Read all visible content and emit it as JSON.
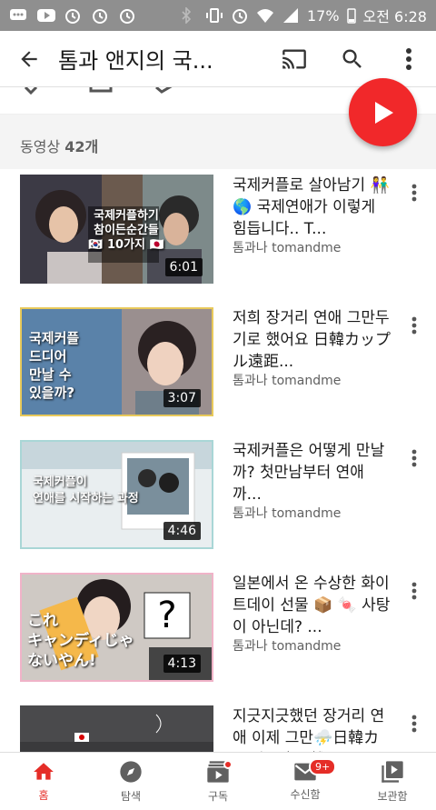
{
  "status_bar": {
    "battery": "17%",
    "time": "오전 6:28"
  },
  "app_bar": {
    "title": "톰과 앤지의 국..."
  },
  "section": {
    "count_label": "동영상",
    "count_value": "42개"
  },
  "videos": [
    {
      "title": "국제커플로 살아남기 👫🌎 국제연애가 이렇게 힘듭니다.. T...",
      "channel": "톰과나 tomandme",
      "duration": "6:01",
      "thumb_text": "국제커플하기\n참이든순간들\n🇰🇷 10가지 🇯🇵"
    },
    {
      "title": "저희 장거리 연애 그만두기로 했어요 日韓カップル遠距...",
      "channel": "톰과나 tomandme",
      "duration": "3:07",
      "thumb_text": "국제커플\n드디어\n만날 수\n있을까?"
    },
    {
      "title": "국제커플은 어떻게 만날까? 첫만남부터 연애까...",
      "channel": "톰과나 tomandme",
      "duration": "4:46",
      "thumb_text": "국제커플이\n연애를 시작하는 과정"
    },
    {
      "title": "일본에서 온 수상한 화이트데이 선물 📦 🍬 사탕이 아닌데? ...",
      "channel": "톰과나 tomandme",
      "duration": "4:13",
      "thumb_text": "これ\nキャンディじゃ\nないやん!"
    },
    {
      "title": "지긋지긋했던 장거리 연애 이제 그만⛈️日韓カップル遠距離...",
      "channel": "",
      "duration": "",
      "thumb_text": ""
    }
  ],
  "bottom_nav": [
    {
      "label": "홈",
      "icon": "home-icon"
    },
    {
      "label": "탐색",
      "icon": "explore-icon"
    },
    {
      "label": "구독",
      "icon": "subscriptions-icon"
    },
    {
      "label": "수신함",
      "icon": "inbox-icon",
      "badge": "9+"
    },
    {
      "label": "보관함",
      "icon": "library-icon"
    }
  ],
  "colors": {
    "accent": "#e52d27",
    "fab": "#f1282a"
  }
}
